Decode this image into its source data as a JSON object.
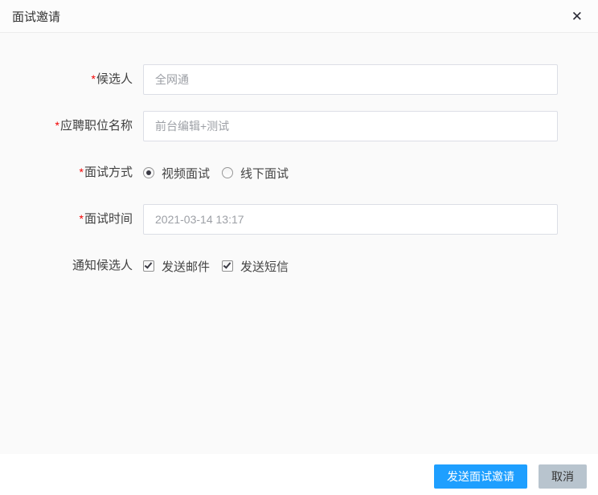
{
  "dialog": {
    "title": "面试邀请",
    "close_glyph": "✕"
  },
  "form": {
    "required_mark": "*",
    "fields": [
      {
        "label": "候选人",
        "required": true,
        "type": "text",
        "value": "全网通"
      },
      {
        "label": "应聘职位名称",
        "required": true,
        "type": "text",
        "value": "前台编辑+测试"
      },
      {
        "label": "面试方式",
        "required": true,
        "type": "radio",
        "options": [
          "视频面试",
          "线下面试"
        ],
        "selected": "视频面试"
      },
      {
        "label": "面试时间",
        "required": true,
        "type": "text",
        "value": "2021-03-14 13:17"
      },
      {
        "label": "通知候选人",
        "required": false,
        "type": "checkbox",
        "options": [
          {
            "label": "发送邮件",
            "checked": true
          },
          {
            "label": "发送短信",
            "checked": true
          }
        ]
      }
    ]
  },
  "footer": {
    "submit_label": "发送面试邀请",
    "cancel_label": "取消"
  },
  "colors": {
    "primary_button": "#1E9FFF",
    "cancel_button": "#B8C4CE",
    "required_asterisk": "#F20000",
    "content_background": "#FAFAFA",
    "input_border": "#DCDEE6",
    "input_text": "#9DA0A6"
  }
}
